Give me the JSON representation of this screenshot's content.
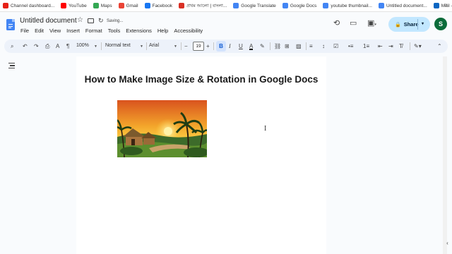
{
  "bookmarks": [
    {
      "label": "Channel dashboard...",
      "color": "#e62117"
    },
    {
      "label": "YouTube",
      "color": "#ff0000"
    },
    {
      "label": "Maps",
      "color": "#34a853"
    },
    {
      "label": "Gmail",
      "color": "#ea4335"
    },
    {
      "label": "Facebook",
      "color": "#1877f2"
    },
    {
      "label": "প্রথম আলো | বাংলা...",
      "color": "#d93025"
    },
    {
      "label": "Google Translate",
      "color": "#4285f4"
    },
    {
      "label": "Google Docs",
      "color": "#4285f4"
    },
    {
      "label": "youtube thumbnail...",
      "color": "#4285f4"
    },
    {
      "label": "Untitled document...",
      "color": "#4285f4"
    },
    {
      "label": "Mail - Md Araf Sk -...",
      "color": "#0a66c2"
    }
  ],
  "bookmarks_more": "»",
  "header": {
    "title": "Untitled document",
    "saving": "Saving...",
    "share_label": "Share",
    "avatar_letter": "S"
  },
  "menu": [
    "File",
    "Edit",
    "View",
    "Insert",
    "Format",
    "Tools",
    "Extensions",
    "Help",
    "Accessibility"
  ],
  "toolbar": {
    "zoom": "100%",
    "style": "Normal text",
    "font": "Arial",
    "font_size": "19"
  },
  "document": {
    "heading": "How to Make Image Size & Rotation in Google Docs"
  },
  "colors": {
    "accent": "#0b57d0",
    "share_bg": "#c2e7ff",
    "toolbar_bg": "#edf2fa",
    "avatar_bg": "#0b6b3a"
  }
}
